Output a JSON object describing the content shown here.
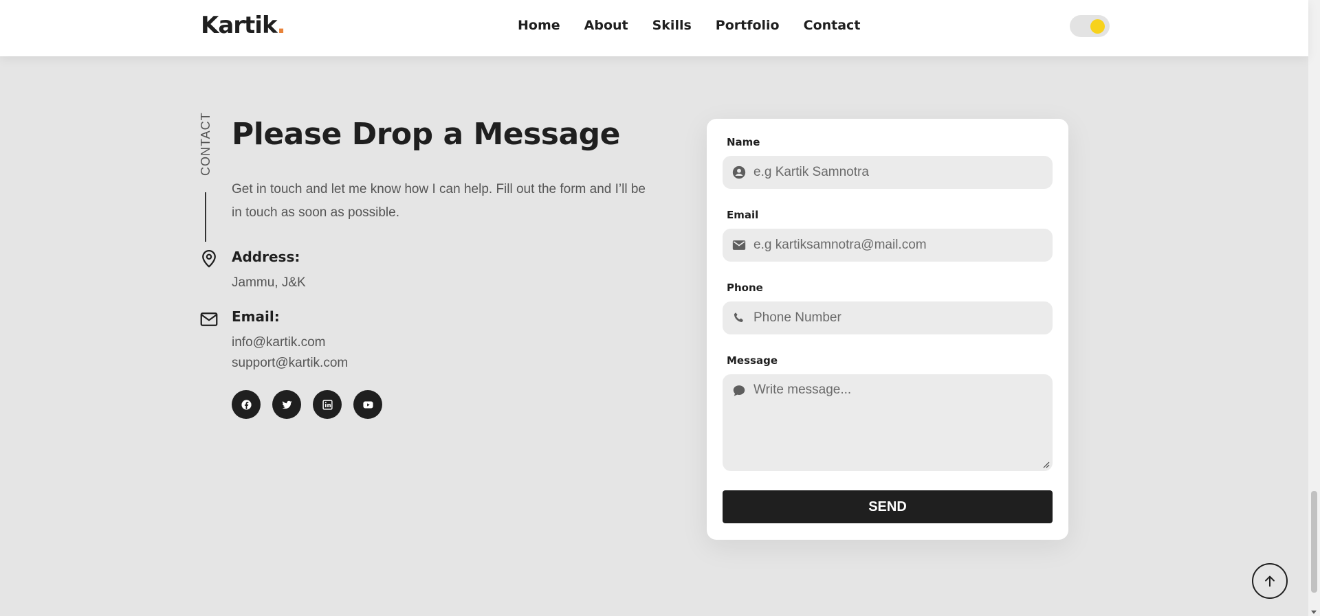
{
  "header": {
    "logo_text": "Kartik",
    "logo_dot": ".",
    "nav": [
      "Home",
      "About",
      "Skills",
      "Portfolio",
      "Contact"
    ],
    "theme_toggle": "on",
    "accent_color": "#e8833a",
    "toggle_color": "#f7d21c"
  },
  "contact": {
    "side_label": "CONTACT",
    "title": "Please Drop a Message",
    "description": "Get in touch and let me know how I can help. Fill out the form and I’ll be in touch as soon as possible.",
    "address_heading": "Address:",
    "address_value": "Jammu, J&K",
    "email_heading": "Email:",
    "email_primary": "info@kartik.com",
    "email_secondary": "support@kartik.com",
    "socials": [
      "facebook-icon",
      "twitter-icon",
      "linkedin-icon",
      "youtube-icon"
    ]
  },
  "form": {
    "name_label": "Name",
    "name_placeholder": "e.g Kartik Samnotra",
    "email_label": "Email",
    "email_placeholder": "e.g kartiksamnotra@mail.com",
    "phone_label": "Phone",
    "phone_placeholder": "Phone Number",
    "message_label": "Message",
    "message_placeholder": "Write message...",
    "send_label": "SEND"
  }
}
